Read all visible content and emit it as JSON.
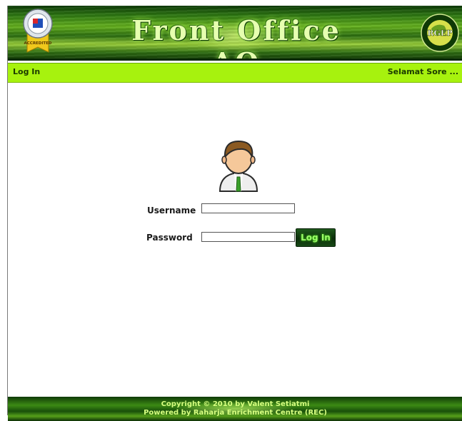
{
  "header": {
    "title": "Front Office AO",
    "left_badge": {
      "label": "ACCREDITED",
      "icon": "university-accreditation-badge-icon"
    },
    "right_logo": {
      "label": "RGEP",
      "icon": "rgep-globe-logo-icon"
    }
  },
  "navbar": {
    "login_link": "Log In",
    "greeting": "Selamat Sore ..."
  },
  "login": {
    "avatar_icon": "user-avatar-icon",
    "username_label": "Username",
    "username_value": "",
    "password_label": "Password",
    "password_value": "",
    "submit_label": "Log In"
  },
  "footer": {
    "line1": "Copyright © 2010 by Valent Setiatmi",
    "line2": "Powered by Raharja Enrichment Centre (REC)"
  },
  "colors": {
    "navbar_bg": "#a7f20e",
    "header_green": "#2f7a12",
    "button_bg": "#0c2d0b"
  }
}
